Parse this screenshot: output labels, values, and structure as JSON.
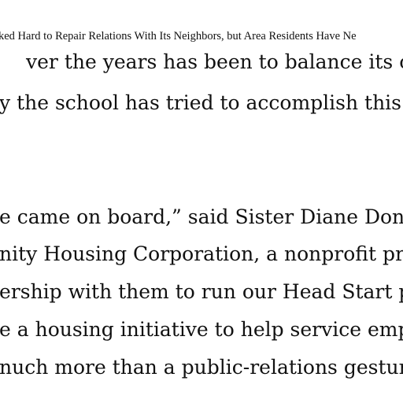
{
  "article": {
    "header_fragment": "ked Hard to Repair Relations With Its Neighbors, but Area Residents Have Ne",
    "lines": [
      "ver the years has been to balance its own n",
      "y the school has tried to accomplish this re",
      "e came on board,” said Sister Diane Dono",
      "nity Housing Corporation, a nonprofit pro",
      "ership with them to run our Head Start pr",
      "e a housing initiative to help service emplo",
      "nuch more than a public-relations gesture"
    ]
  }
}
